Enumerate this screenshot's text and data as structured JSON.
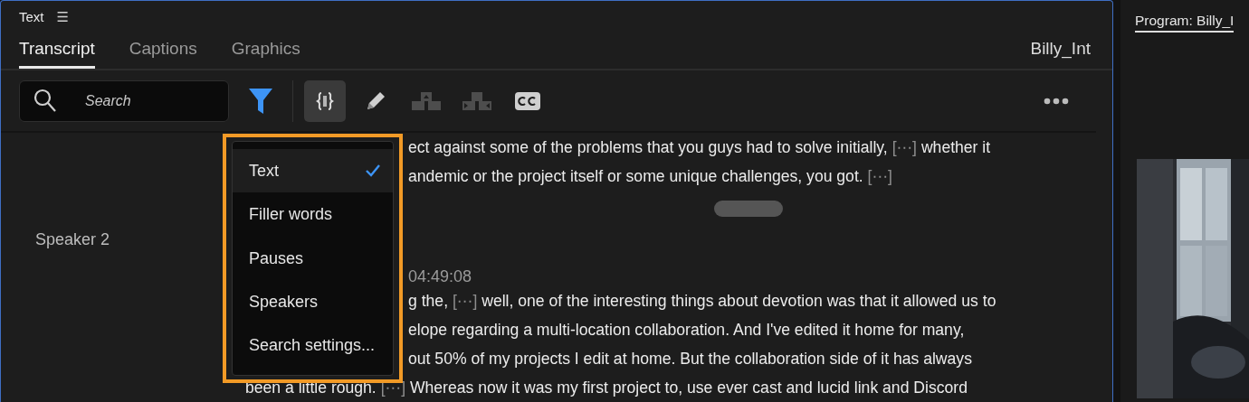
{
  "panel": {
    "title": "Text",
    "menu_glyph": "☰",
    "tabs": [
      {
        "label": "Transcript",
        "selected": true
      },
      {
        "label": "Captions",
        "selected": false
      },
      {
        "label": "Graphics",
        "selected": false
      }
    ],
    "clip_name": "Billy_Int"
  },
  "toolbar": {
    "search": {
      "placeholder": "Search"
    },
    "filter_active": true,
    "tools": [
      {
        "kind": "brackets",
        "selected": true,
        "disabled": false
      },
      {
        "kind": "pencil",
        "selected": false,
        "disabled": false
      },
      {
        "kind": "split-up",
        "selected": false,
        "disabled": true
      },
      {
        "kind": "split-arrows",
        "selected": false,
        "disabled": true
      },
      {
        "kind": "cc",
        "selected": false,
        "disabled": false
      }
    ]
  },
  "filter_menu": {
    "items": [
      {
        "label": "Text",
        "checked": true
      },
      {
        "label": "Filler words",
        "checked": false
      },
      {
        "label": "Pauses",
        "checked": false
      },
      {
        "label": "Speakers",
        "checked": false
      },
      {
        "label": "Search settings...",
        "checked": false
      }
    ]
  },
  "transcript": {
    "lines": [
      {
        "kind": "text",
        "covered": true,
        "segments": [
          {
            "kind": "word",
            "text": "ect against some of the problems that you guys had to solve initially,"
          },
          {
            "kind": "gap",
            "text": "[⋯]"
          },
          {
            "kind": "word",
            "text": "whether it"
          }
        ]
      },
      {
        "kind": "text",
        "covered": true,
        "segments": [
          {
            "kind": "word",
            "text": "andemic or the project itself or some unique challenges, you got."
          },
          {
            "kind": "gap",
            "text": "[⋯]"
          }
        ]
      },
      {
        "kind": "handle"
      },
      {
        "kind": "speaker",
        "speaker": "Speaker 2",
        "time": "04:49:08",
        "covered": true
      },
      {
        "kind": "text",
        "covered": true,
        "segments": [
          {
            "kind": "word",
            "text": "g the,"
          },
          {
            "kind": "gap",
            "text": "[⋯]"
          },
          {
            "kind": "word",
            "text": "well, one of the interesting things about devotion was that it allowed us to"
          }
        ]
      },
      {
        "kind": "text",
        "covered": true,
        "segments": [
          {
            "kind": "word",
            "text": "elope regarding a multi-location collaboration. And I've edited it home for many,"
          }
        ]
      },
      {
        "kind": "text",
        "covered": true,
        "segments": [
          {
            "kind": "word",
            "text": "out 50% of my projects I edit at home. But the collaboration side of it has always"
          }
        ]
      },
      {
        "kind": "text",
        "covered": false,
        "segments": [
          {
            "kind": "word",
            "text": "been a little rough."
          },
          {
            "kind": "gap",
            "text": "[⋯]"
          },
          {
            "kind": "word",
            "text": "Whereas now it was my first project to, use ever cast and lucid link and Discord"
          }
        ]
      }
    ]
  },
  "program_panel": {
    "title": "Program: Billy_I"
  }
}
